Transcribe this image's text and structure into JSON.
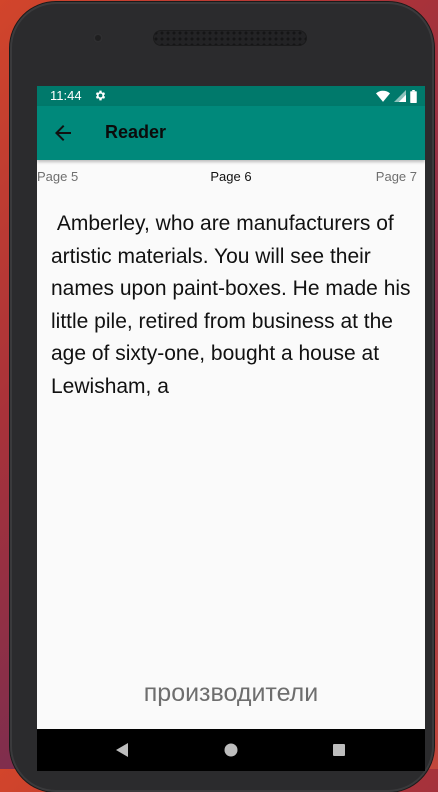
{
  "status_bar": {
    "time": "11:44",
    "icons": [
      "settings-gear-icon",
      "wifi-icon",
      "signal-icon",
      "battery-icon"
    ]
  },
  "app_bar": {
    "title": "Reader",
    "back_icon": "arrow-back-icon",
    "color": "#00897b"
  },
  "pagination": {
    "prev_label": "Page 5",
    "current_label": "Page 6",
    "next_label": "Page 7"
  },
  "reader": {
    "text": " Amberley, who are manufacturers of artistic materials. You will see their names upon paint-boxes. He made his little pile, retired from business at the age of sixty-one, bought a house at Lewisham, a"
  },
  "translation": {
    "word": "производители"
  },
  "nav_bar": {
    "buttons": [
      "back-triangle-icon",
      "home-circle-icon",
      "recents-square-icon"
    ]
  }
}
